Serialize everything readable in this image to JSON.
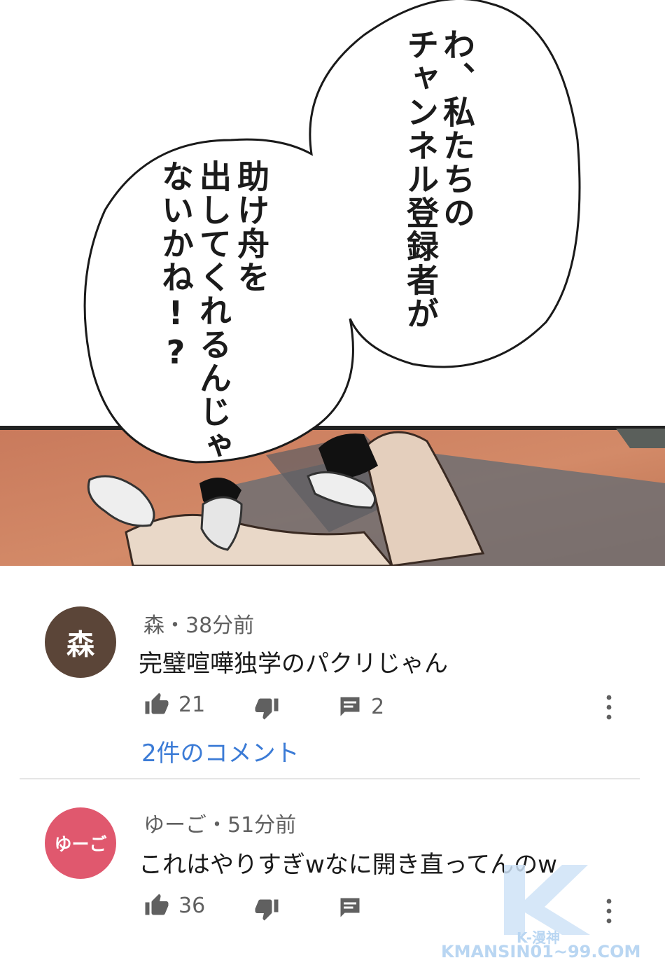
{
  "manga": {
    "bubble_right_lines": [
      "わ、私たちの",
      "チャンネル登録者が"
    ],
    "bubble_left_lines": [
      "助け舟を",
      "出してくれるんじゃ",
      "ないかね!?"
    ]
  },
  "comments": [
    {
      "avatar_text": "森",
      "avatar_color": "#5b4538",
      "author": "森",
      "time": "38分前",
      "text": "完璧喧嘩独学のパクリじゃん",
      "likes": "21",
      "replies": "2",
      "replies_link": "2件のコメント"
    },
    {
      "avatar_text": "ゆーご",
      "avatar_color": "#e0586e",
      "author": "ゆーご",
      "time": "51分前",
      "text": "これはやりすぎwなに開き直ってんのw",
      "likes": "36"
    }
  ],
  "meta_separator": "・",
  "watermark": {
    "brand": "K-漫神",
    "url": "KMANSIN01~99.COM"
  },
  "colors": {
    "link": "#3b7bd6",
    "muted": "#606060",
    "divider": "#e5e5e5"
  }
}
